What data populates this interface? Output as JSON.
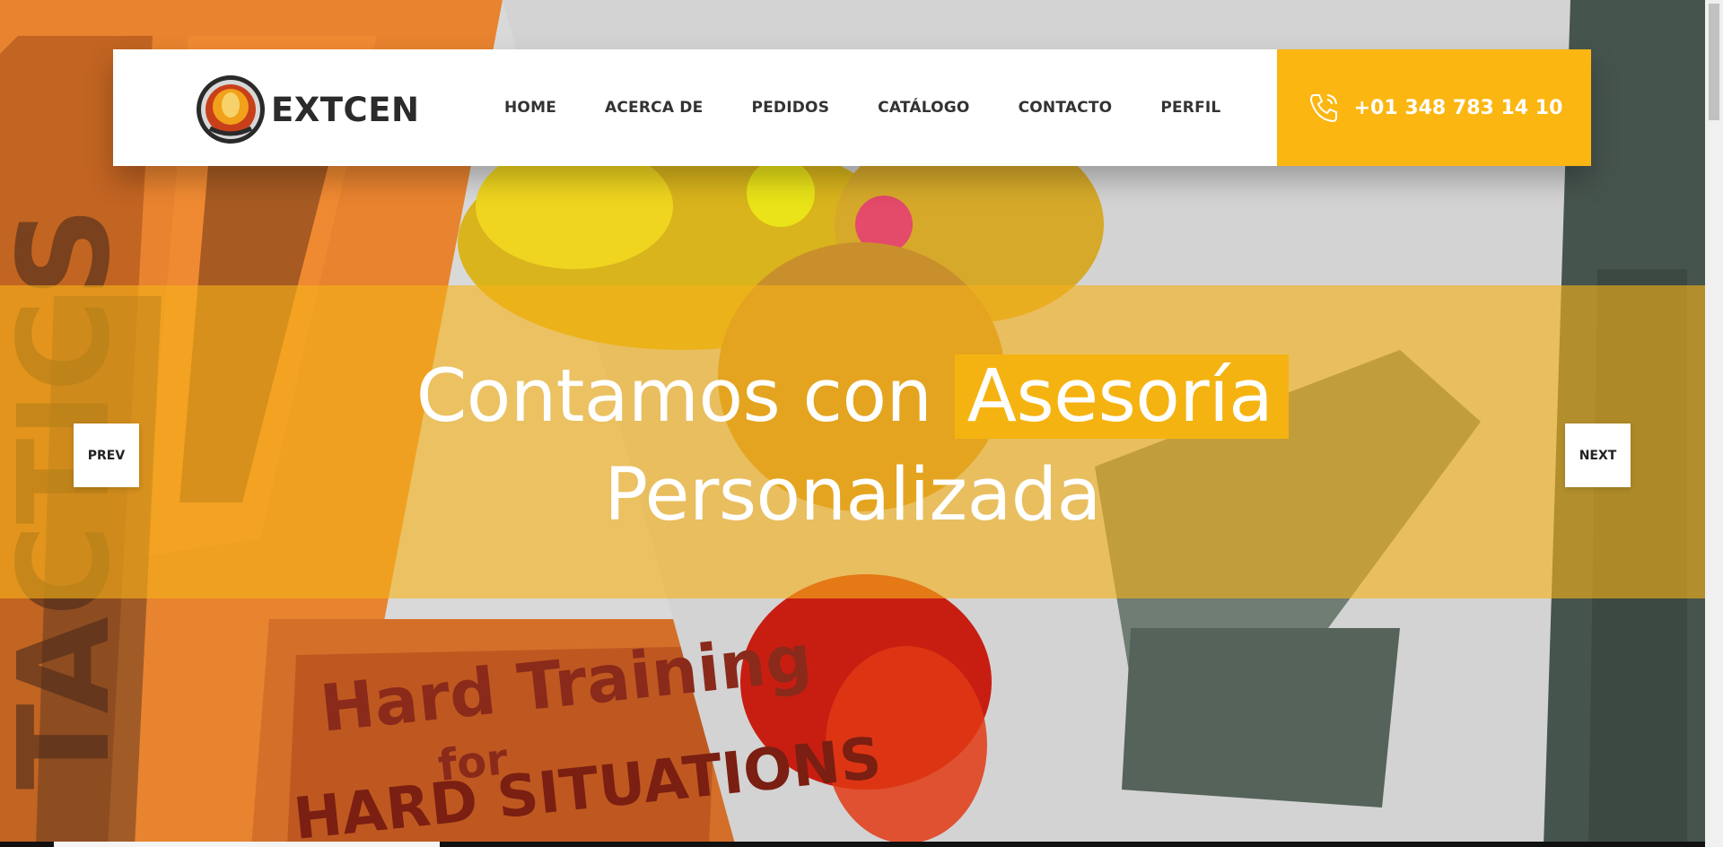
{
  "brand": {
    "name": "EXTCEN",
    "logo_icon": "fire-extinguisher-badge"
  },
  "nav": {
    "items": [
      {
        "label": "HOME"
      },
      {
        "label": "ACERCA DE"
      },
      {
        "label": "PEDIDOS"
      },
      {
        "label": "CATÁLOGO"
      },
      {
        "label": "CONTACTO"
      },
      {
        "label": "PERFIL"
      }
    ]
  },
  "contact": {
    "phone": "+01 348 783 14 10",
    "icon": "phone-icon"
  },
  "hero": {
    "line1_plain": "Contamos con ",
    "line1_highlight": "Asesoría",
    "line2": "Personalizada",
    "prev_label": "PREV",
    "next_label": "NEXT",
    "band_color": "#f6b218",
    "highlight_color": "#f5b312"
  },
  "colors": {
    "accent": "#fbb611",
    "nav_text": "#333333"
  }
}
